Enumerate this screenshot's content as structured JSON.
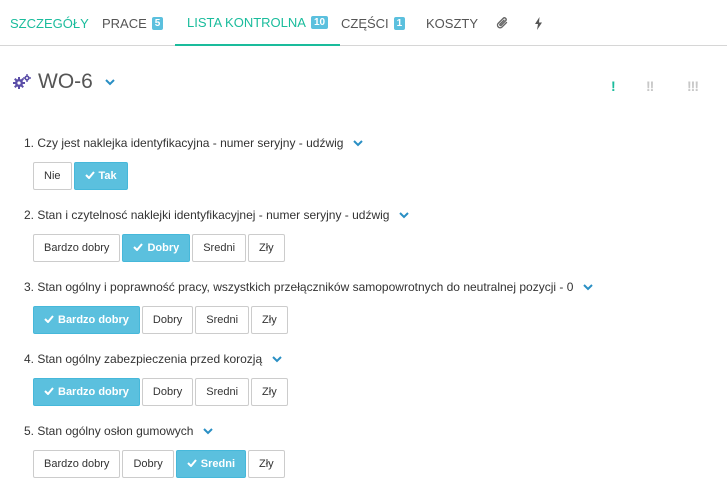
{
  "tabs": [
    {
      "label": "SZCZEGÓŁY"
    },
    {
      "label": "PRACE",
      "badge": "5"
    },
    {
      "label": "LISTA KONTROLNA",
      "badge": "10"
    },
    {
      "label": "CZĘŚCI",
      "badge": "1"
    },
    {
      "label": "KOSZTY"
    }
  ],
  "icons": {
    "attachment": "paperclip-icon",
    "actions": "bolt-icon",
    "wo": "gears-icon",
    "dropdown": "chevron-down-icon",
    "check": "check-icon"
  },
  "colors": {
    "accent": "#1abc9c",
    "selected": "#5bc0de",
    "chevron": "#2a8fc4",
    "gear": "#5b4ea8"
  },
  "header": {
    "title": "WO-6"
  },
  "priorities": [
    "!",
    "!!",
    "!!!"
  ],
  "checklist": [
    {
      "question": "1. Czy jest naklejka identyfikacyjna - numer seryjny - udźwig",
      "options": [
        "Nie",
        "Tak"
      ],
      "selected": "Tak"
    },
    {
      "question": "2. Stan i czytelnosć naklejki identyfikacyjnej - numer seryjny - udźwig",
      "options": [
        "Bardzo dobry",
        "Dobry",
        "Sredni",
        "Zły"
      ],
      "selected": "Dobry"
    },
    {
      "question": "3. Stan ogólny i poprawność pracy, wszystkich przełączników samopowrotnych do neutralnej pozycji - 0",
      "options": [
        "Bardzo dobry",
        "Dobry",
        "Sredni",
        "Zły"
      ],
      "selected": "Bardzo dobry"
    },
    {
      "question": "4. Stan ogólny zabezpieczenia przed korozją",
      "options": [
        "Bardzo dobry",
        "Dobry",
        "Sredni",
        "Zły"
      ],
      "selected": "Bardzo dobry"
    },
    {
      "question": "5. Stan ogólny osłon gumowych",
      "options": [
        "Bardzo dobry",
        "Dobry",
        "Sredni",
        "Zły"
      ],
      "selected": "Sredni"
    }
  ]
}
